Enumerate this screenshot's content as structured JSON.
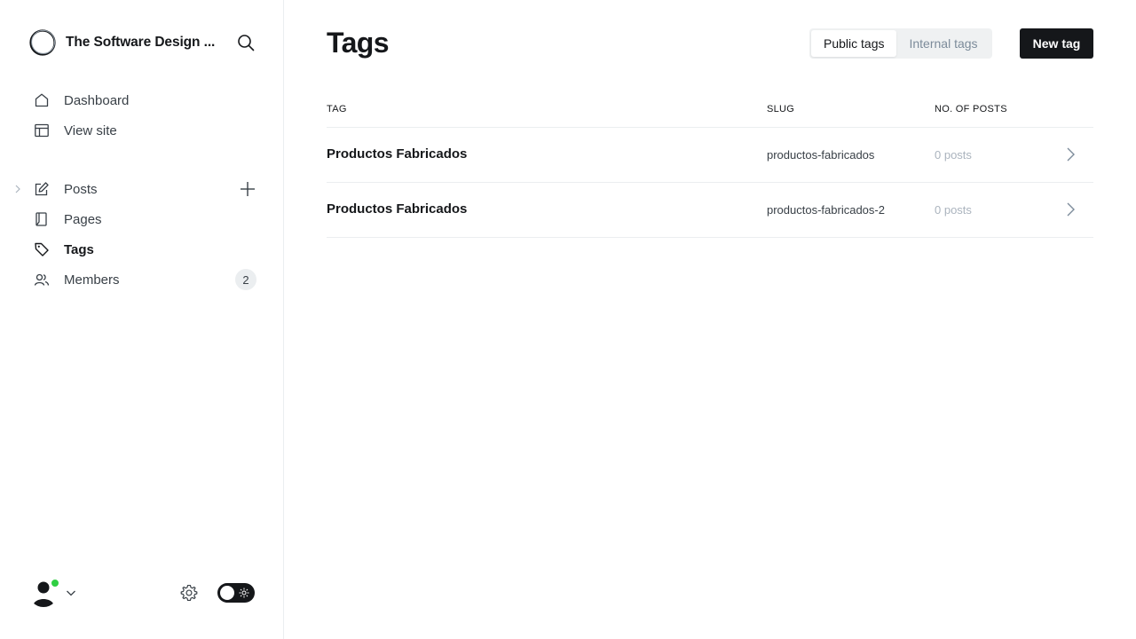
{
  "sidebar": {
    "site_title": "The Software Design ...",
    "nav_primary": [
      {
        "label": "Dashboard",
        "icon": "home-icon"
      },
      {
        "label": "View site",
        "icon": "layout-icon"
      }
    ],
    "nav_secondary": [
      {
        "label": "Posts",
        "icon": "pencil-icon"
      },
      {
        "label": "Pages",
        "icon": "page-icon"
      },
      {
        "label": "Tags",
        "icon": "tag-icon",
        "active": true
      },
      {
        "label": "Members",
        "icon": "members-icon",
        "badge": "2"
      }
    ]
  },
  "main": {
    "title": "Tags",
    "tabs": [
      {
        "label": "Public tags",
        "active": true
      },
      {
        "label": "Internal tags",
        "active": false
      }
    ],
    "new_button": "New tag",
    "table": {
      "headers": {
        "tag": "TAG",
        "slug": "SLUG",
        "posts": "NO. OF POSTS"
      },
      "rows": [
        {
          "name": "Productos Fabricados",
          "slug": "productos-fabricados",
          "posts": "0 posts"
        },
        {
          "name": "Productos Fabricados",
          "slug": "productos-fabricados-2",
          "posts": "0 posts"
        }
      ]
    }
  },
  "colors": {
    "text": "#15171a",
    "muted": "#abb4be",
    "border": "#ebeef0",
    "online": "#30cf43"
  }
}
